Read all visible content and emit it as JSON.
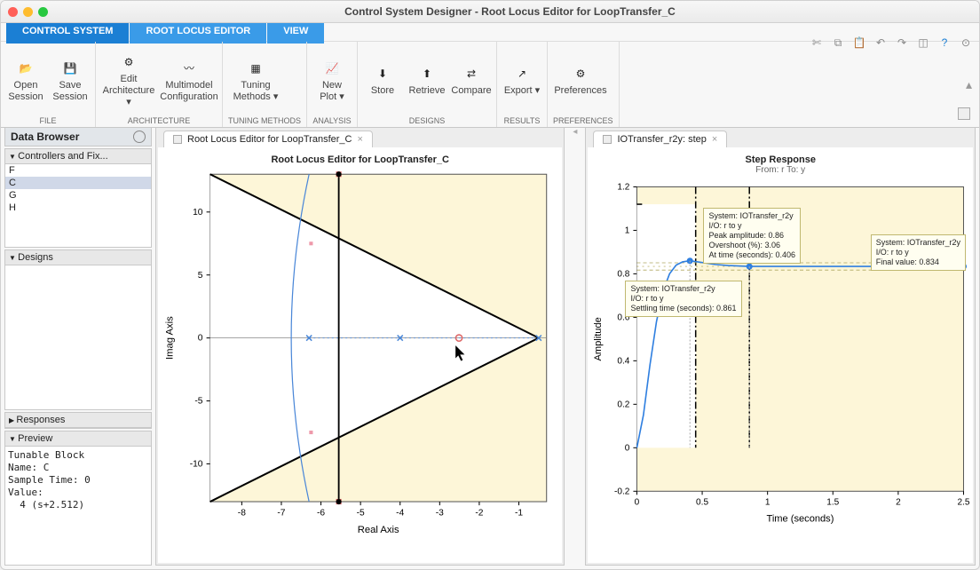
{
  "window": {
    "title": "Control System Designer - Root Locus Editor for LoopTransfer_C"
  },
  "tabs": [
    {
      "label": "CONTROL SYSTEM",
      "active": true
    },
    {
      "label": "ROOT LOCUS EDITOR",
      "active": false
    },
    {
      "label": "VIEW",
      "active": false
    }
  ],
  "toolstrip": {
    "sections": [
      {
        "label": "FILE",
        "items": [
          "Open\nSession",
          "Save\nSession"
        ]
      },
      {
        "label": "ARCHITECTURE",
        "items": [
          "Edit\nArchitecture ▾",
          "Multimodel\nConfiguration"
        ]
      },
      {
        "label": "TUNING METHODS",
        "items": [
          "Tuning\nMethods ▾"
        ]
      },
      {
        "label": "ANALYSIS",
        "items": [
          "New\nPlot ▾"
        ]
      },
      {
        "label": "DESIGNS",
        "items": [
          "Store",
          "Retrieve",
          "Compare"
        ]
      },
      {
        "label": "RESULTS",
        "items": [
          "Export ▾"
        ]
      },
      {
        "label": "PREFERENCES",
        "items": [
          "Preferences"
        ]
      }
    ]
  },
  "data_browser": {
    "title": "Data Browser",
    "controllers_header": "Controllers and Fix...",
    "controllers": [
      "F",
      "C",
      "G",
      "H"
    ],
    "selected_controller": "C",
    "designs_header": "Designs",
    "responses_header": "Responses",
    "preview_header": "Preview",
    "preview_text": "Tunable Block\nName: C\nSample Time: 0\nValue:\n  4 (s+2.512)"
  },
  "root_locus": {
    "tab_label": "Root Locus Editor for LoopTransfer_C",
    "title": "Root Locus Editor for LoopTransfer_C",
    "xlabel": "Real Axis",
    "ylabel": "Imag Axis",
    "x_ticks": [
      -8,
      -7,
      -6,
      -5,
      -4,
      -3,
      -2,
      -1
    ],
    "y_ticks": [
      -10,
      -5,
      0,
      5,
      10
    ],
    "xlim": [
      -8.8,
      -0.3
    ],
    "ylim": [
      -13,
      13
    ]
  },
  "step_response": {
    "tab_label": "IOTransfer_r2y: step",
    "title": "Step Response",
    "subtitle": "From: r  To: y",
    "xlabel": "Time (seconds)",
    "ylabel": "Amplitude",
    "x_ticks": [
      0,
      0.5,
      1,
      1.5,
      2,
      2.5
    ],
    "y_ticks": [
      -0.2,
      0,
      0.2,
      0.4,
      0.6,
      0.8,
      1,
      1.2
    ],
    "xlim": [
      0,
      2.5
    ],
    "ylim": [
      -0.2,
      1.2
    ],
    "annotations": {
      "peak": {
        "line1": "System: IOTransfer_r2y",
        "line2": "I/O: r to y",
        "line3": "Peak amplitude: 0.86",
        "line4": "Overshoot (%): 3.06",
        "line5": "At time (seconds): 0.406"
      },
      "settling": {
        "line1": "System: IOTransfer_r2y",
        "line2": "I/O: r to y",
        "line3": "Settling time (seconds): 0.861"
      },
      "final": {
        "line1": "System: IOTransfer_r2y",
        "line2": "I/O: r to y",
        "line3": "Final value: 0.834"
      }
    }
  },
  "chart_data": [
    {
      "type": "scatter",
      "name": "Root Locus Editor for LoopTransfer_C",
      "xlabel": "Real Axis",
      "ylabel": "Imag Axis",
      "xlim": [
        -8.8,
        -0.3
      ],
      "ylim": [
        -13,
        13
      ],
      "x_ticks": [
        -8,
        -7,
        -6,
        -5,
        -4,
        -3,
        -2,
        -1
      ],
      "y_ticks": [
        -10,
        -5,
        0,
        5,
        10
      ],
      "open_loop_poles": [
        [
          -4,
          0
        ],
        [
          -6.3,
          0
        ],
        [
          -0.5,
          0
        ]
      ],
      "compensator_zero": [
        -2.512,
        0
      ],
      "closed_loop_poles": [
        [
          -5.55,
          13
        ],
        [
          -5.55,
          -13
        ]
      ],
      "asymptote_intersection": [
        -0.5,
        0
      ],
      "asymptote_slope_deg": 63,
      "locus_branches": "vertical locus near x=-5.55 between y=-13 and 13; curved locus from x≈-6.5 bowing left through (-7,0); real-axis segments between -6.3→-4 and -2.5→-0.5",
      "constraint_lines": "two straight black lines from (-0.5,0) to (-8.8,±13) bounding damping region",
      "cursor_position": [
        -2.6,
        -0.6
      ]
    },
    {
      "type": "line",
      "name": "Step Response",
      "subtitle": "From: r  To: y",
      "xlabel": "Time (seconds)",
      "ylabel": "Amplitude",
      "xlim": [
        0,
        2.5
      ],
      "ylim": [
        -0.2,
        1.2
      ],
      "x_ticks": [
        0,
        0.5,
        1,
        1.5,
        2,
        2.5
      ],
      "y_ticks": [
        -0.2,
        0,
        0.2,
        0.4,
        0.6,
        0.8,
        1,
        1.2
      ],
      "series": [
        {
          "name": "IOTransfer_r2y",
          "x": [
            0,
            0.05,
            0.1,
            0.15,
            0.2,
            0.25,
            0.3,
            0.35,
            0.406,
            0.5,
            0.6,
            0.7,
            0.861,
            1.0,
            1.5,
            2.0,
            2.5
          ],
          "y": [
            0,
            0.15,
            0.38,
            0.58,
            0.72,
            0.8,
            0.84,
            0.855,
            0.86,
            0.852,
            0.843,
            0.838,
            0.834,
            0.834,
            0.834,
            0.834,
            0.834
          ]
        }
      ],
      "peak": {
        "time": 0.406,
        "value": 0.86,
        "overshoot_pct": 3.06
      },
      "settling_time": 0.861,
      "final_value": 0.834,
      "initial_lines": [
        [
          "horizontal",
          1.12,
          0,
          0.02
        ]
      ],
      "reference_dashed": 0.834
    }
  ]
}
